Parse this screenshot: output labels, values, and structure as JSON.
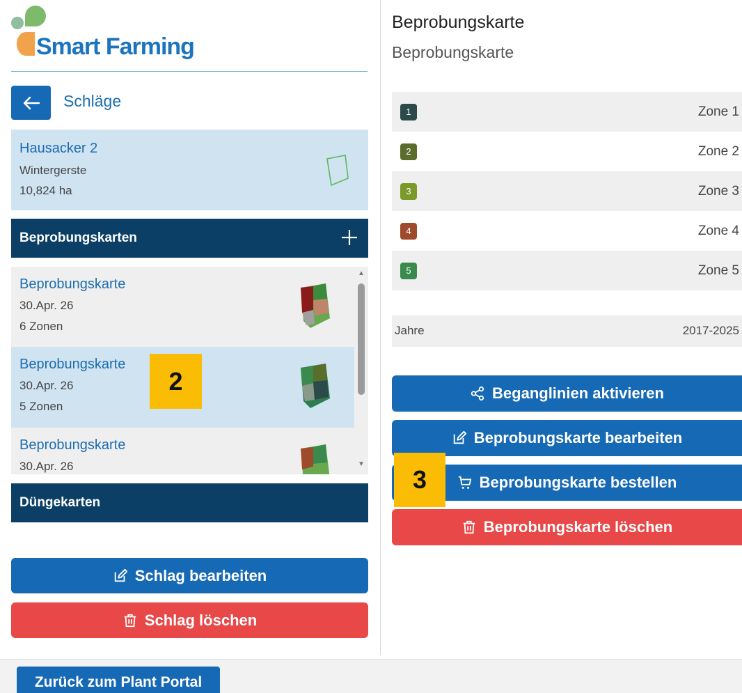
{
  "brand": {
    "name": "Smart Farming"
  },
  "nav": {
    "back_title": "Schläge"
  },
  "field": {
    "name": "Hausacker 2",
    "crop": "Wintergerste",
    "area": "10,824 ha"
  },
  "sections": {
    "beprobungskarten": "Beprobungskarten",
    "duengekarten": "Düngekarten"
  },
  "maps_list": [
    {
      "title": "Beprobungskarte",
      "date": "30.Apr. 26",
      "zones": "6 Zonen",
      "selected": false
    },
    {
      "title": "Beprobungskarte",
      "date": "30.Apr. 26",
      "zones": "5 Zonen",
      "selected": true
    },
    {
      "title": "Beprobungskarte",
      "date": "30.Apr. 26",
      "zones": "",
      "selected": false
    }
  ],
  "left_buttons": {
    "edit": "Schlag bearbeiten",
    "delete": "Schlag löschen"
  },
  "detail": {
    "title": "Beprobungskarte",
    "subtitle": "Beprobungskarte",
    "zones": [
      {
        "num": "1",
        "label": "Zone 1",
        "color": "#2d4a4a"
      },
      {
        "num": "2",
        "label": "Zone 2",
        "color": "#5a6e2c"
      },
      {
        "num": "3",
        "label": "Zone 3",
        "color": "#7a9a2a"
      },
      {
        "num": "4",
        "label": "Zone 4",
        "color": "#a04a2c"
      },
      {
        "num": "5",
        "label": "Zone 5",
        "color": "#3a8a4e"
      }
    ],
    "years_label": "Jahre",
    "years_value": "2017-2025",
    "buttons": {
      "activate": "Beganglinien aktivieren",
      "edit": "Beprobungskarte bearbeiten",
      "order": "Beprobungskarte bestellen",
      "delete": "Beprobungskarte löschen"
    }
  },
  "footer": {
    "portal": "Zurück zum Plant Portal"
  },
  "markers": {
    "m2": "2",
    "m3": "3"
  },
  "colors": {
    "primary": "#1669b5",
    "danger": "#e84848",
    "header_dark": "#0b3f65",
    "selected_bg": "#cfe3f1"
  }
}
